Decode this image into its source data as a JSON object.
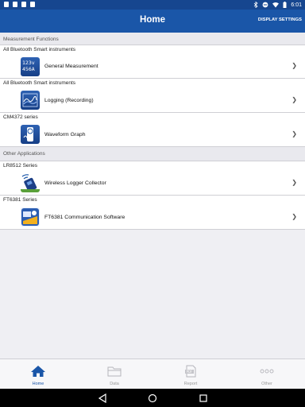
{
  "status_bar": {
    "time": "6:01"
  },
  "header": {
    "title": "Home",
    "display_settings": "DISPLAY SETTINGS"
  },
  "sections": [
    {
      "header": "Measurement Functions",
      "rows": [
        {
          "series": "All Bluetooth Smart instruments",
          "label": "General Measurement",
          "icon": "lcd-meter-icon",
          "lcd_line1": "123v",
          "lcd_line2": "456A"
        },
        {
          "series": "All Bluetooth Smart instruments",
          "label": "Logging (Recording)",
          "icon": "logging-graph-icon"
        },
        {
          "series": "CM4372 series",
          "label": "Waveform Graph",
          "icon": "waveform-clamp-icon"
        }
      ]
    },
    {
      "header": "Other Applications",
      "rows": [
        {
          "series": "LR8512 Series",
          "label": "Wireless Logger Collector",
          "icon": "wireless-logger-icon"
        },
        {
          "series": "FT6381 Series",
          "label": "FT6381 Communication Software",
          "icon": "ft6381-app-icon"
        }
      ]
    }
  ],
  "chevron": "❯",
  "tabs": [
    {
      "label": "Home",
      "icon": "home-icon",
      "active": true
    },
    {
      "label": "Data",
      "icon": "folder-icon",
      "active": false
    },
    {
      "label": "Report",
      "icon": "pdf-report-icon",
      "active": false
    },
    {
      "label": "Other",
      "icon": "more-dots-icon",
      "active": false
    }
  ],
  "colors": {
    "appbar": "#1a56a8",
    "statusbar": "#16468f",
    "active_tab": "#1a56a8"
  }
}
